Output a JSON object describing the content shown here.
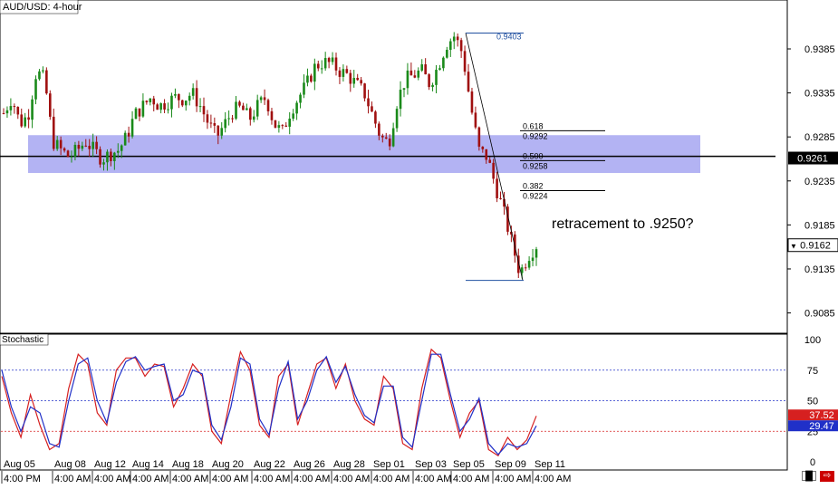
{
  "chart_data": [
    {
      "type": "candlestick",
      "title": "AUD/USD: 4-hour",
      "y_axis_ticks": [
        "0.9385",
        "0.9335",
        "0.9285",
        "0.9235",
        "0.9185",
        "0.9135",
        "0.9085"
      ],
      "ylim": [
        0.9065,
        0.942
      ],
      "current_price_label": "0.9261",
      "last_price_label": "0.9162",
      "fib_high_label": "0.9403",
      "fib_levels": [
        {
          "ratio": "0.618",
          "price": "0.9292"
        },
        {
          "ratio": "0.500",
          "price": "0.9258"
        },
        {
          "ratio": "0.382",
          "price": "0.9224"
        }
      ],
      "annotation": "retracement to .9250?",
      "support_zone": [
        0.9244,
        0.9287
      ],
      "horizontal_line": 0.9263,
      "swing_high": 0.9403,
      "swing_low": 0.9122,
      "x_labels": [
        {
          "date": "Aug 05",
          "time": "4:00 PM"
        },
        {
          "date": "Aug 08",
          "time": "4:00 AM"
        },
        {
          "date": "Aug 12",
          "time": "4:00 AM"
        },
        {
          "date": "Aug 14",
          "time": "4:00 AM"
        },
        {
          "date": "Aug 18",
          "time": "4:00 AM"
        },
        {
          "date": "Aug 20",
          "time": "4:00 AM"
        },
        {
          "date": "Aug 22",
          "time": "4:00 AM"
        },
        {
          "date": "Aug 26",
          "time": "4:00 AM"
        },
        {
          "date": "Aug 28",
          "time": "4:00 AM"
        },
        {
          "date": "Sep 01",
          "time": "4:00 AM"
        },
        {
          "date": "Sep 03",
          "time": "4:00 AM"
        },
        {
          "date": "Sep 05",
          "time": "4:00 AM"
        },
        {
          "date": "Sep 09",
          "time": "4:00 AM"
        },
        {
          "date": "Sep 11",
          "time": "4:00 AM"
        }
      ],
      "price_path": [
        0.9312,
        0.933,
        0.93,
        0.931,
        0.936,
        0.935,
        0.928,
        0.927,
        0.9262,
        0.927,
        0.928,
        0.927,
        0.926,
        0.9266,
        0.927,
        0.9285,
        0.931,
        0.932,
        0.933,
        0.932,
        0.9325,
        0.933,
        0.9328,
        0.9335,
        0.932,
        0.93,
        0.9285,
        0.93,
        0.9315,
        0.9318,
        0.9305,
        0.932,
        0.933,
        0.93,
        0.929,
        0.9315,
        0.933,
        0.9345,
        0.9365,
        0.937,
        0.9368,
        0.936,
        0.9355,
        0.9345,
        0.9335,
        0.931,
        0.9285,
        0.9278,
        0.9325,
        0.935,
        0.9355,
        0.936,
        0.9345,
        0.9365,
        0.939,
        0.94,
        0.938,
        0.932,
        0.927,
        0.9262,
        0.923,
        0.92,
        0.9165,
        0.913,
        0.915,
        0.9162
      ]
    },
    {
      "type": "line",
      "title": "Stochastic",
      "y_axis_ticks": [
        "100",
        "75",
        "50",
        "25",
        "0"
      ],
      "ylim": [
        0,
        100
      ],
      "levels": [
        75,
        50,
        25
      ],
      "value_labels": [
        "37.52",
        "29.47"
      ],
      "series": [
        {
          "color": "#d62020",
          "values": [
            70,
            40,
            20,
            55,
            30,
            10,
            15,
            60,
            88,
            80,
            40,
            30,
            75,
            85,
            85,
            70,
            80,
            78,
            45,
            60,
            80,
            70,
            25,
            15,
            55,
            90,
            75,
            30,
            20,
            70,
            80,
            30,
            55,
            80,
            85,
            60,
            80,
            50,
            35,
            30,
            70,
            60,
            15,
            10,
            60,
            92,
            85,
            50,
            20,
            40,
            50,
            10,
            5,
            20,
            10,
            18,
            37.52
          ]
        },
        {
          "color": "#2030c8",
          "values": [
            75,
            45,
            25,
            45,
            40,
            15,
            12,
            50,
            80,
            85,
            50,
            32,
            65,
            82,
            86,
            75,
            78,
            80,
            50,
            55,
            75,
            72,
            30,
            18,
            45,
            85,
            80,
            35,
            22,
            60,
            82,
            35,
            50,
            75,
            86,
            65,
            78,
            55,
            38,
            32,
            62,
            62,
            20,
            12,
            50,
            88,
            88,
            55,
            25,
            35,
            52,
            15,
            6,
            15,
            12,
            15,
            29.47
          ]
        }
      ]
    }
  ],
  "panel_label": "Stochastic",
  "accent_colors": {
    "zone": "#9a9aef",
    "up": "#1a8a1a",
    "down": "#a01010",
    "line": "#000000"
  }
}
